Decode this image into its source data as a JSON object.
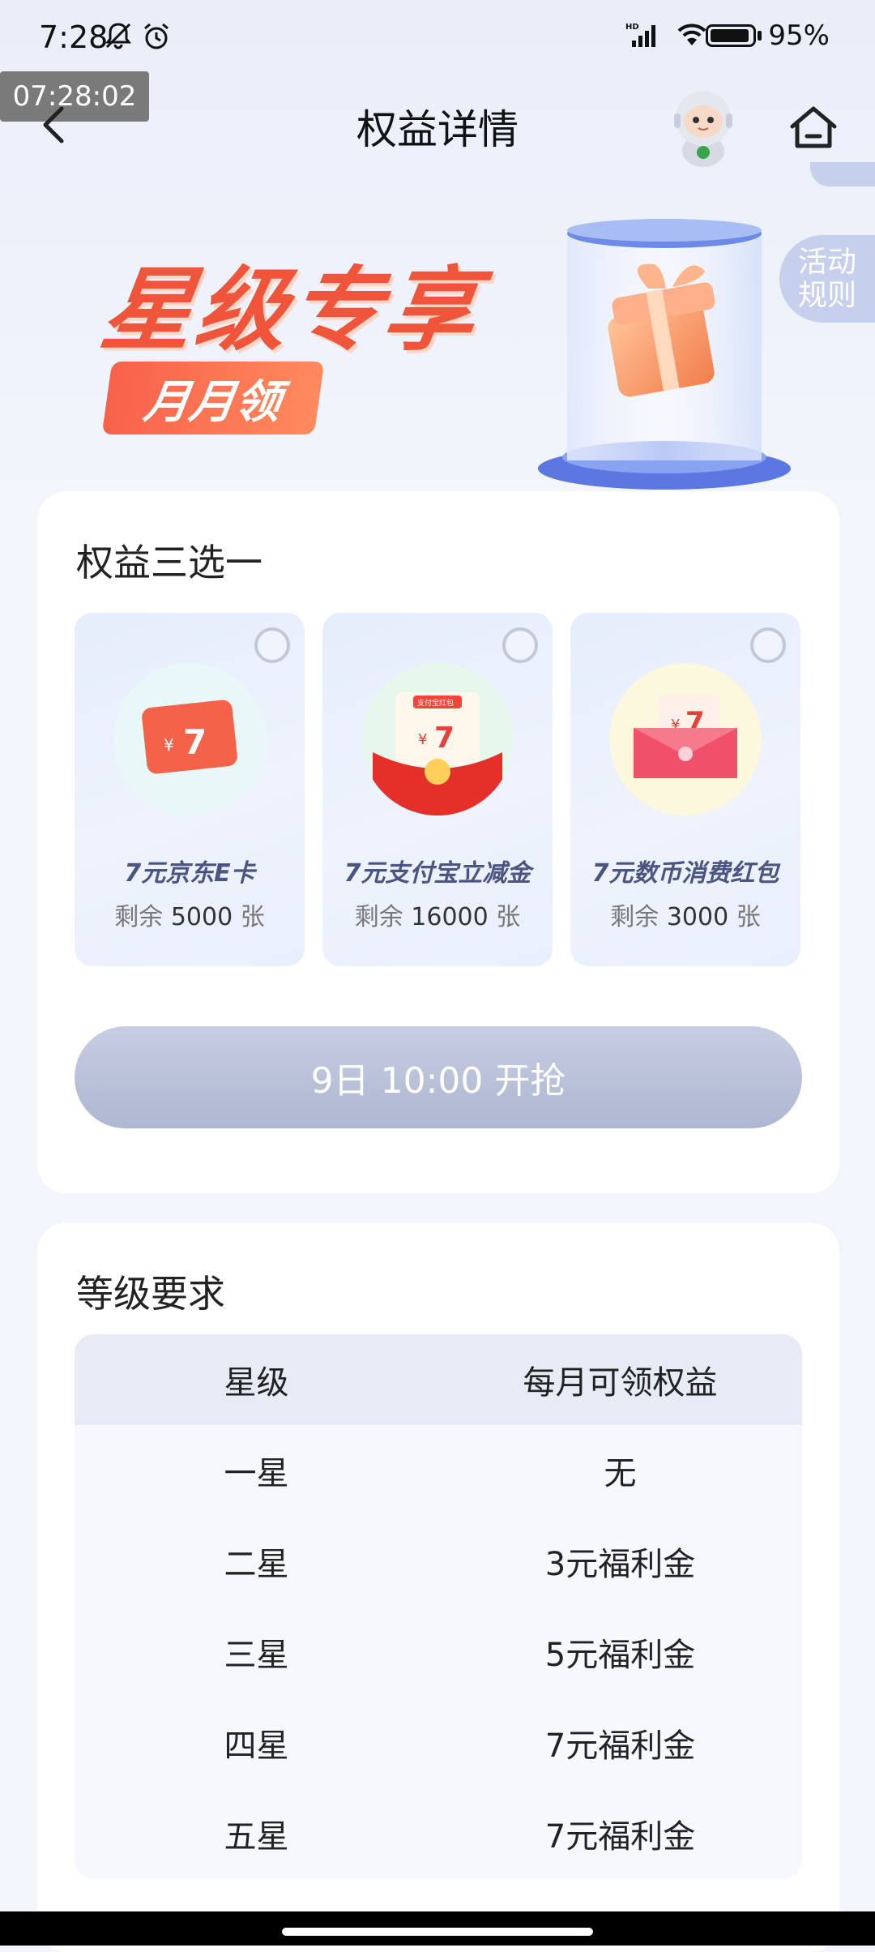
{
  "status_bar": {
    "time": "7:28",
    "battery": "95%",
    "icons": [
      "bell-off-icon",
      "alarm-icon",
      "hd-signal-icon",
      "wifi-icon",
      "battery-icon"
    ],
    "signal_label": "HD"
  },
  "overlay_clock": "07:28:02",
  "nav": {
    "title": "权益详情",
    "side_tab_line1": "活动",
    "side_tab_line2": "规则"
  },
  "banner": {
    "title": "星级专享",
    "badge": "月月领"
  },
  "benefits_section": {
    "title": "权益三选一",
    "items": [
      {
        "name": "7元京东E卡",
        "stock_prefix": "剩余",
        "stock": "5000",
        "stock_unit": "张",
        "icon_value": "7",
        "icon_currency": "¥"
      },
      {
        "name": "7元支付宝立减金",
        "stock_prefix": "剩余",
        "stock": "16000",
        "stock_unit": "张",
        "icon_value": "7",
        "icon_currency": "¥",
        "icon_tag": "支付宝红包"
      },
      {
        "name": "7元数币消费红包",
        "stock_prefix": "剩余",
        "stock": "3000",
        "stock_unit": "张",
        "icon_value": "7",
        "icon_currency": "¥"
      }
    ],
    "button": "9日 10:00 开抢"
  },
  "level_section": {
    "title": "等级要求",
    "headers": [
      "星级",
      "每月可领权益"
    ],
    "rows": [
      [
        "一星",
        "无"
      ],
      [
        "二星",
        "3元福利金"
      ],
      [
        "三星",
        "5元福利金"
      ],
      [
        "四星",
        "7元福利金"
      ],
      [
        "五星",
        "7元福利金"
      ]
    ]
  }
}
